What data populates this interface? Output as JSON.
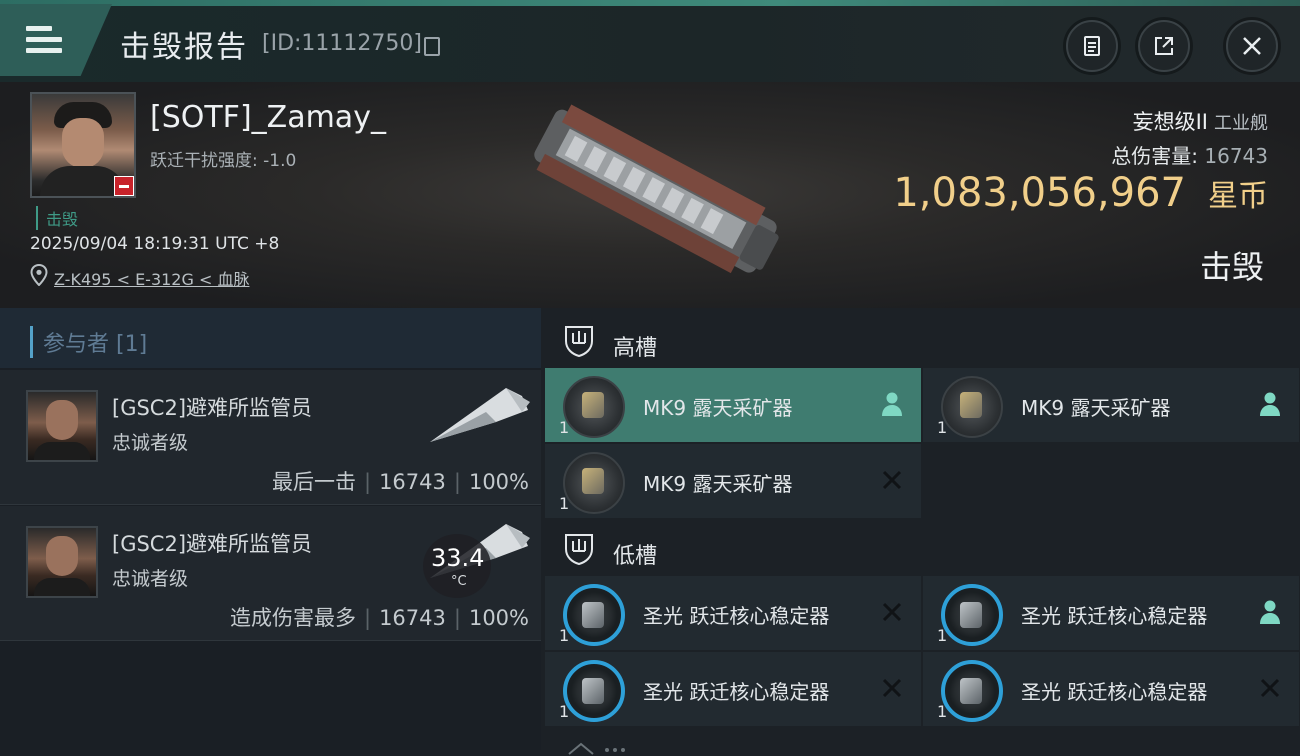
{
  "header": {
    "title": "击毁报告",
    "kill_id": "[ID:11112750]",
    "buttons": [
      "clipboard-icon",
      "share-icon",
      "close-icon"
    ]
  },
  "victim": {
    "name": "[SOTF]_Zamay_",
    "warp_scramble": "跃迁干扰强度: -1.0",
    "status": "击毁",
    "datetime": "2025/09/04 18:19:31 UTC +8",
    "location": "Z-K495 < E-312G < 血脉",
    "ship_class": "妄想级II",
    "ship_type": "工业舰",
    "damage_label": "总伤害量:",
    "damage_value": "16743",
    "isk_value": "1,083,056,967",
    "isk_unit": "星币",
    "result": "击毁"
  },
  "participants": {
    "header": "参与者 [1]",
    "rows": [
      {
        "corp": "[GSC2]避难所监管员",
        "rank": "忠诚者级",
        "tag": "最后一击",
        "damage": "16743",
        "percent": "100%"
      },
      {
        "corp": "[GSC2]避难所监管员",
        "rank": "忠诚者级",
        "tag": "造成伤害最多",
        "damage": "16743",
        "percent": "100%"
      }
    ]
  },
  "overlay": {
    "temperature": "33.4",
    "unit": "°C"
  },
  "fitting": {
    "high": {
      "label": "高槽",
      "slots": [
        {
          "name": "MK9 露天采矿器",
          "qty": "1",
          "state": "person-icon",
          "active": true
        },
        {
          "name": "MK9 露天采矿器",
          "qty": "1",
          "state": "person-icon",
          "active": false
        },
        {
          "name": "MK9 露天采矿器",
          "qty": "1",
          "state": "destroyed-icon",
          "active": false
        }
      ]
    },
    "low": {
      "label": "低槽",
      "slots": [
        {
          "name": "圣光 跃迁核心稳定器",
          "qty": "1",
          "state": "destroyed-icon"
        },
        {
          "name": "圣光 跃迁核心稳定器",
          "qty": "1",
          "state": "person-icon"
        },
        {
          "name": "圣光 跃迁核心稳定器",
          "qty": "1",
          "state": "destroyed-icon"
        },
        {
          "name": "圣光 跃迁核心稳定器",
          "qty": "1",
          "state": "destroyed-icon"
        }
      ]
    }
  },
  "colors": {
    "accent": "#3f7c70",
    "isk": "#f1cf8a",
    "blue_ring": "#2ea0d8"
  }
}
